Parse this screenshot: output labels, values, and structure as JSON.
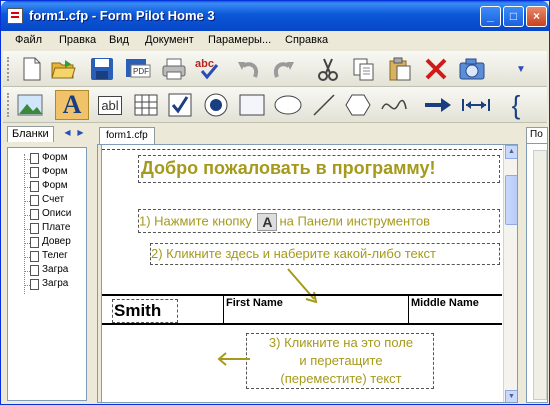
{
  "window": {
    "title": "form1.cfp - Form Pilot Home 3",
    "controls": {
      "minimize": "_",
      "maximize": "□",
      "close": "×"
    }
  },
  "menu": [
    "Файл",
    "Правка",
    "Вид",
    "Документ",
    "Парамеры...",
    "Справка"
  ],
  "toolbar1": {
    "icons": [
      "new-document-icon",
      "open-folder-icon",
      "save-icon",
      "pdf-export-icon",
      "print-icon",
      "spellcheck-icon",
      "undo-icon",
      "redo-icon",
      "cut-icon",
      "copy-icon",
      "paste-icon",
      "delete-icon",
      "camera-icon"
    ],
    "pdf_label": "PDF",
    "spell_label": "abc"
  },
  "toolbar2": {
    "icons": [
      "image-tool-icon",
      "text-tool-icon",
      "textfield-tool-icon",
      "table-tool-icon",
      "checkbox-tool-icon",
      "radio-tool-icon",
      "rectangle-tool-icon",
      "ellipse-tool-icon",
      "line-tool-icon",
      "polygon-tool-icon",
      "curve-tool-icon",
      "arrow-tool-icon",
      "dimension-tool-icon",
      "brace-tool-icon"
    ],
    "text_tool_glyph": "A",
    "textfield_glyph": "abl",
    "brace_glyph": "{"
  },
  "left_panel": {
    "tab": "Бланки",
    "items": [
      "Форм",
      "Форм",
      "Форм",
      "Счет",
      "Описи",
      "Плате",
      "Довер",
      "Телег",
      "Загра",
      "Загра"
    ]
  },
  "document": {
    "tab": "form1.cfp",
    "heading": "Добро пожаловать в программу!",
    "step1_before": "1) Нажмите кнопку",
    "step1_icon": "A",
    "step1_after": "на Панели инструментов",
    "step2": "2) Кликните здесь и наберите какой-либо текст",
    "table_headers": [
      "First Name",
      "Middle Name"
    ],
    "name_value": "Smith",
    "step3_lines": [
      "3) Кликните на это поле",
      "и перетащите",
      "(переместите) текст"
    ]
  },
  "right_panel": {
    "tab": "По"
  },
  "colors": {
    "accent_text": "#a59a1c",
    "titlebar": "#0b58d8"
  }
}
